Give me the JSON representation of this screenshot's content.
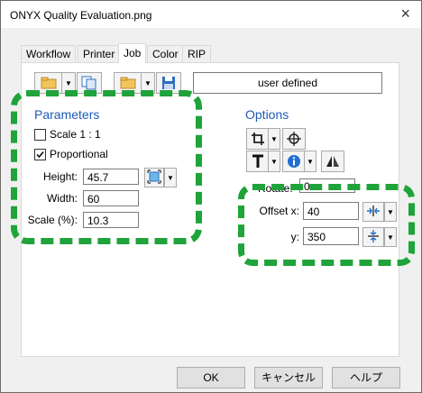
{
  "window": {
    "title": "ONYX Quality Evaluation.png",
    "close_glyph": "×"
  },
  "tabs": [
    "Workflow",
    "Printer",
    "Job",
    "Color",
    "RIP"
  ],
  "active_tab": "Job",
  "toolbar": {
    "preset_value": "user defined"
  },
  "parameters": {
    "heading": "Parameters",
    "scale_1_1_label": "Scale 1 : 1",
    "scale_1_1_checked": false,
    "proportional_label": "Proportional",
    "proportional_checked": true,
    "height_label": "Height:",
    "height_value": "45.7",
    "width_label": "Width:",
    "width_value": "60",
    "scale_label": "Scale (%):",
    "scale_value": "10.3"
  },
  "options": {
    "heading": "Options",
    "rotate_label": "Rotate:",
    "rotate_value": "0",
    "offset_x_label": "Offset x:",
    "offset_x_value": "40",
    "offset_y_label": "y:",
    "offset_y_value": "350"
  },
  "buttons": {
    "ok": "OK",
    "cancel": "キャンセル",
    "help": "ヘルプ"
  },
  "colors": {
    "accent_blue": "#1e5ab8",
    "highlight_green": "#1fa33a"
  }
}
